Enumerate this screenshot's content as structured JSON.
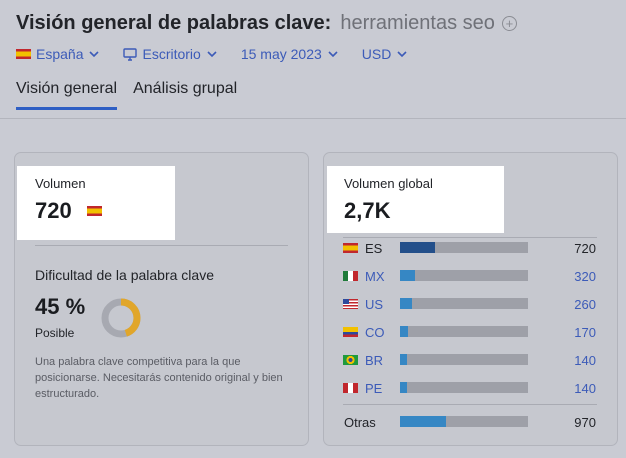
{
  "header": {
    "title": "Visión general de palabras clave:",
    "keyword": "herramientas seo",
    "add_icon": "plus-circle-icon"
  },
  "filters": {
    "country": "España",
    "device": "Escritorio",
    "date": "15 may 2023",
    "currency": "USD"
  },
  "tabs": [
    {
      "label": "Visión general",
      "active": true
    },
    {
      "label": "Análisis grupal",
      "active": false
    }
  ],
  "volume": {
    "label": "Volumen",
    "value": "720",
    "flag": "flag-es-icon"
  },
  "keyword_difficulty": {
    "label": "Dificultad de la palabra clave",
    "value": "45 %",
    "level": "Posible",
    "percent": 45,
    "description": "Una palabra clave competitiva para la que posicionarse. Necesitarás contenido original y bien estructurado.",
    "color": "#e1a62a"
  },
  "global_volume": {
    "label": "Volumen global",
    "value": "2,7K",
    "countries": [
      {
        "code": "ES",
        "value": "720",
        "share": 0.27,
        "link": false,
        "flag": "es"
      },
      {
        "code": "MX",
        "value": "320",
        "share": 0.12,
        "link": true,
        "flag": "mx"
      },
      {
        "code": "US",
        "value": "260",
        "share": 0.095,
        "link": true,
        "flag": "us"
      },
      {
        "code": "CO",
        "value": "170",
        "share": 0.065,
        "link": true,
        "flag": "co"
      },
      {
        "code": "BR",
        "value": "140",
        "share": 0.055,
        "link": true,
        "flag": "br"
      },
      {
        "code": "PE",
        "value": "140",
        "share": 0.055,
        "link": true,
        "flag": "pe"
      }
    ],
    "others": {
      "label": "Otras",
      "value": "970",
      "share": 0.36
    },
    "colors": {
      "primary": "#234f8a",
      "secondary": "#3687c4"
    }
  }
}
